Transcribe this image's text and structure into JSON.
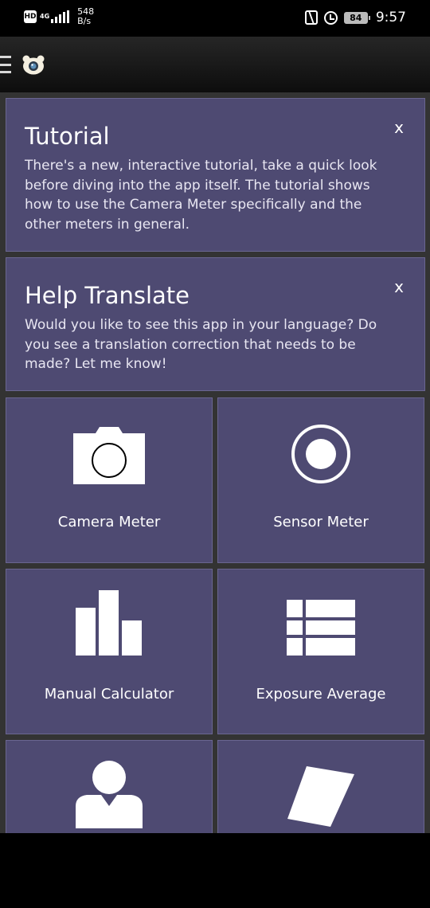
{
  "status_bar": {
    "hd": "HD",
    "network_type": "4G",
    "net_speed_value": "548",
    "net_speed_unit": "B/s",
    "battery": "84",
    "time": "9:57"
  },
  "cards": {
    "tutorial": {
      "title": "Tutorial",
      "text": "There's a new, interactive tutorial, take a quick look before diving into the app itself. The tutorial shows how to use the Camera Meter specifically and the other meters in general.",
      "close": "x"
    },
    "translate": {
      "title": "Help Translate",
      "text": "Would you like to see this app in your language? Do you see a translation correction that needs to be made? Let me know!",
      "close": "x"
    }
  },
  "tiles": {
    "camera_meter": {
      "label": "Camera Meter",
      "icon": "camera-icon"
    },
    "sensor_meter": {
      "label": "Sensor Meter",
      "icon": "record-icon"
    },
    "manual_calculator": {
      "label": "Manual Calculator",
      "icon": "bar-chart-icon"
    },
    "exposure_average": {
      "label": "Exposure Average",
      "icon": "list-grid-icon"
    },
    "portrait": {
      "label": "",
      "icon": "person-icon"
    },
    "card": {
      "label": "",
      "icon": "gray-card-icon"
    }
  },
  "colors": {
    "card_background": "#4e4a72",
    "content_background": "#333333",
    "toolbar_background": "#1a1a1a"
  }
}
